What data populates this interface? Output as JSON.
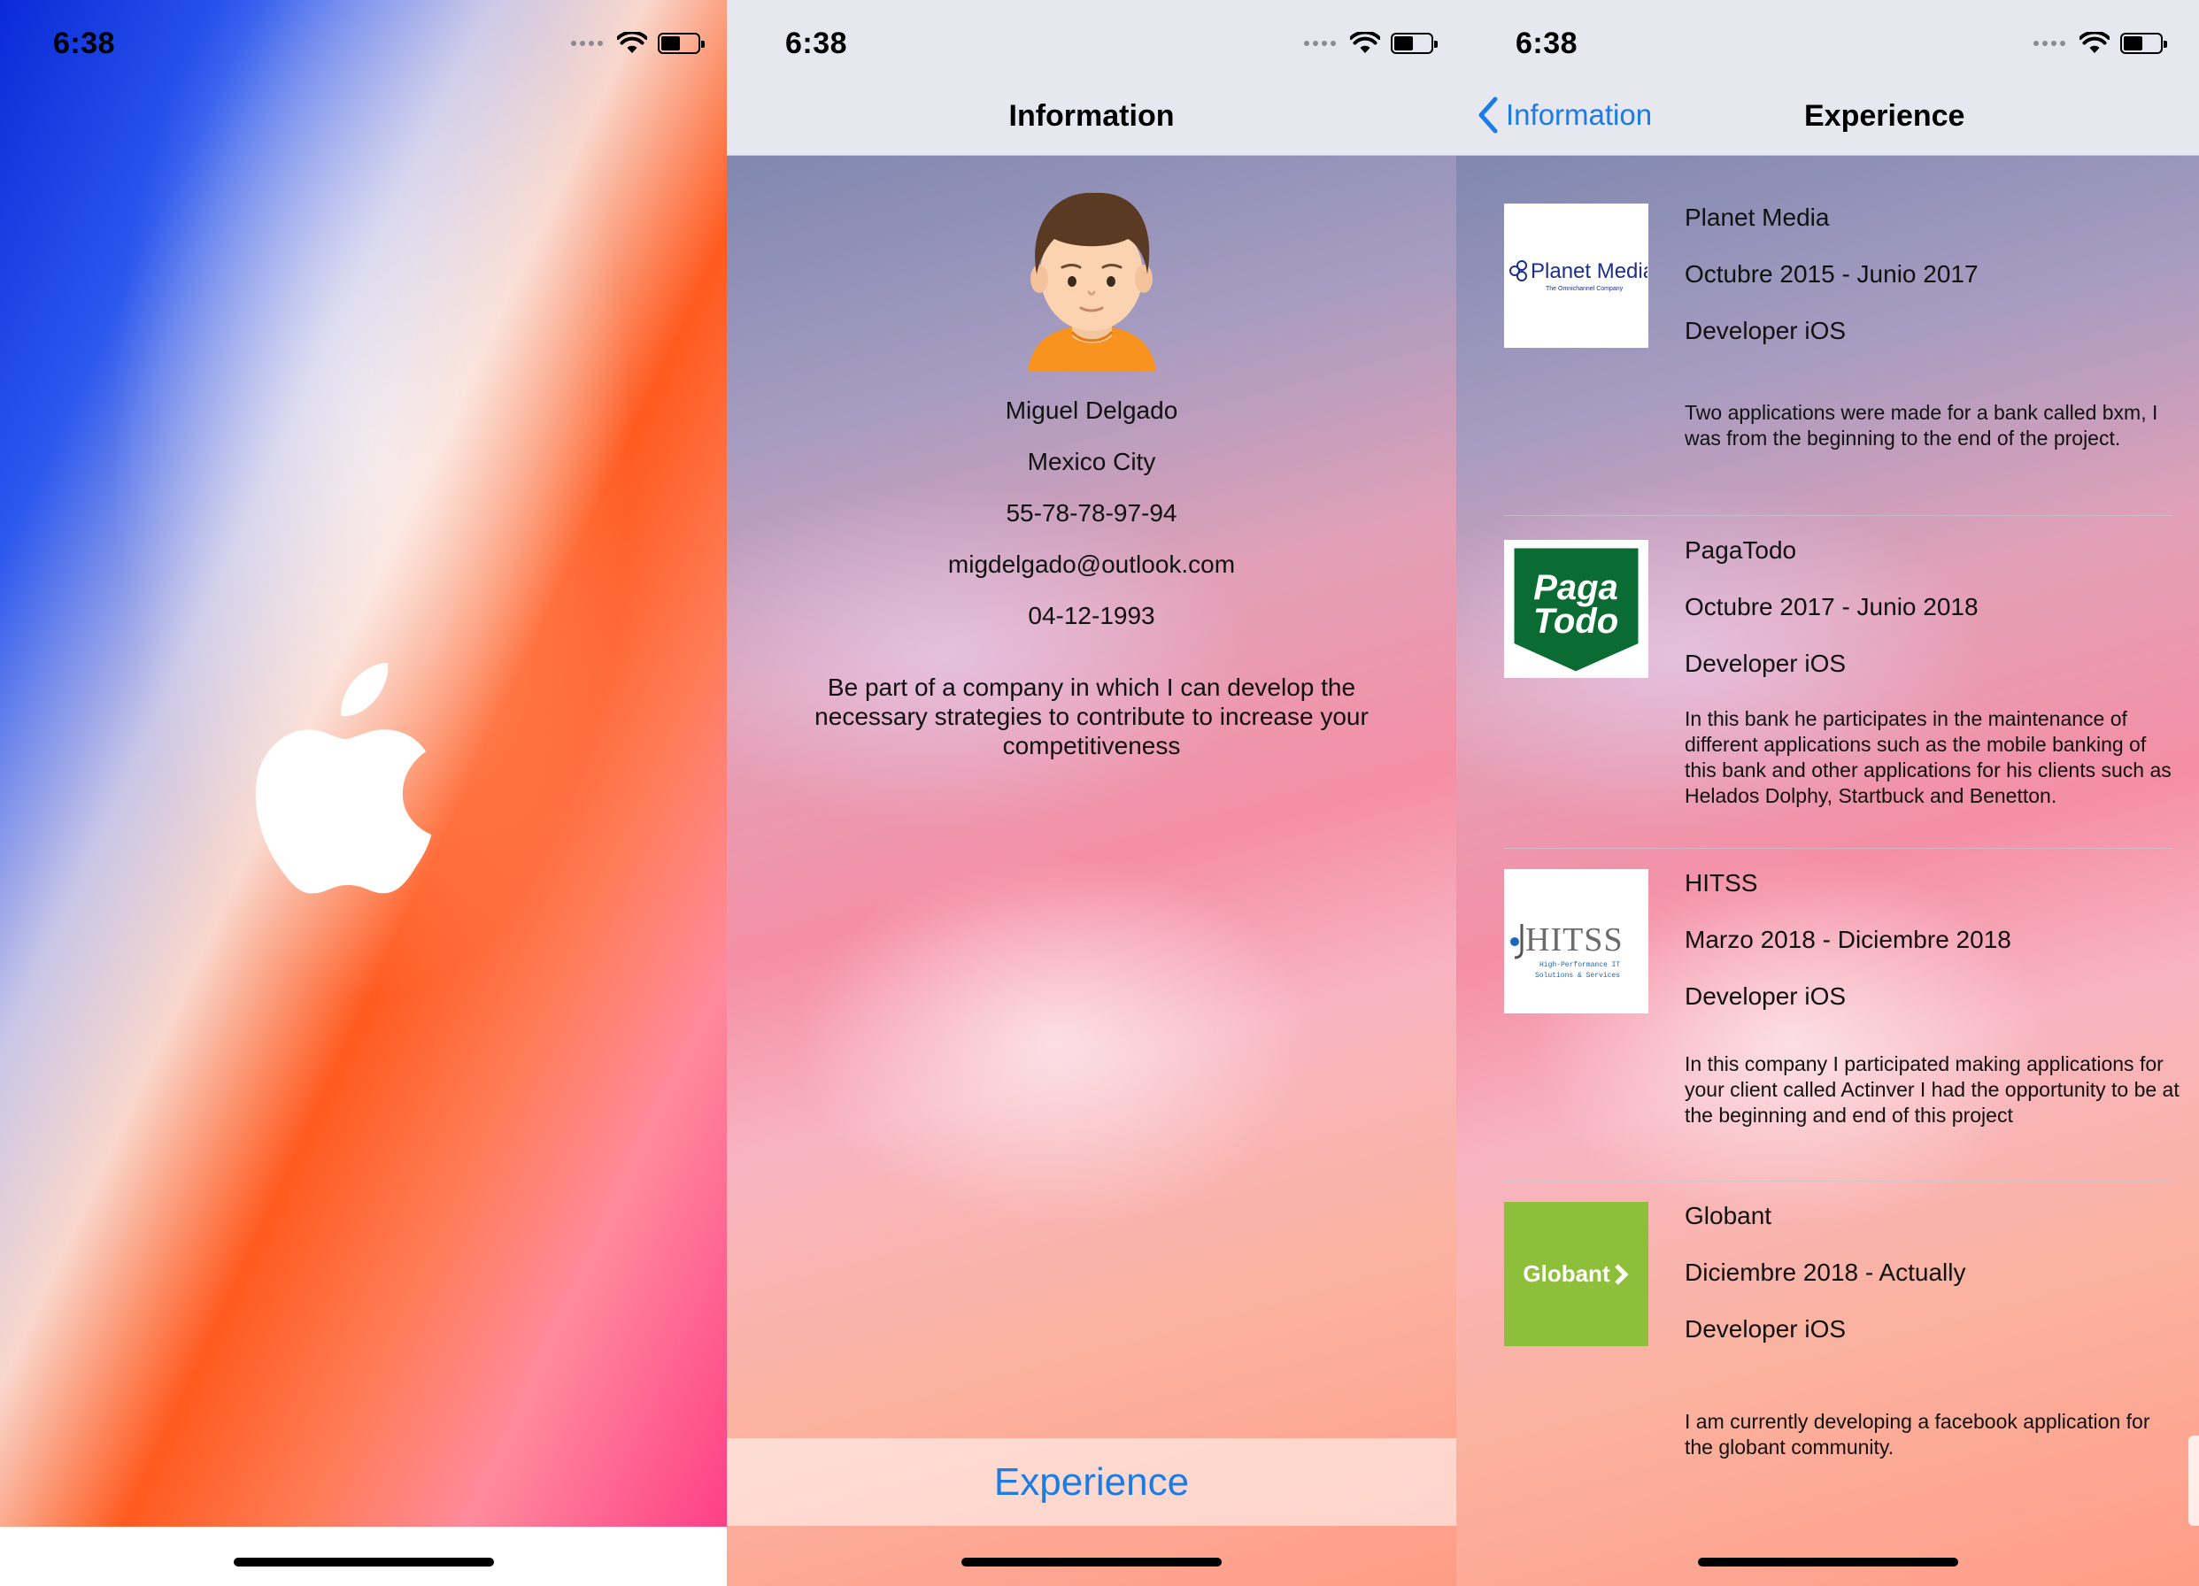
{
  "status_bar": {
    "time": "6:38"
  },
  "splash": {
    "logo_icon": "apple-logo-icon"
  },
  "information": {
    "nav_title": "Information",
    "avatar_icon": "person-avatar-icon",
    "name": "Miguel Delgado",
    "city": "Mexico City",
    "phone": "55-78-78-97-94",
    "email": "migdelgado@outlook.com",
    "birthdate": "04-12-1993",
    "objective": "Be part of a company in which I can develop the necessary strategies to contribute to increase your competitiveness",
    "experience_button": "Experience"
  },
  "experience": {
    "back_label": "Information",
    "nav_title": "Experience",
    "jobs": [
      {
        "company": "Planet Media",
        "period": "Octubre 2015 - Junio 2017",
        "role": "Developer iOS",
        "description": "Two applications were made for a bank called bxm, I was from the beginning to the end of the project.",
        "logo_text": "Planet Media",
        "logo_tagline": "The Omnichannel Company"
      },
      {
        "company": "PagaTodo",
        "period": "Octubre 2017 - Junio 2018",
        "role": "Developer iOS",
        "description": "In this bank he participates in the maintenance of different applications such as the mobile banking of this bank and other applications for his clients such as Helados Dolphy, Startbuck and Benetton.",
        "logo_text_1": "Paga",
        "logo_text_2": "Todo"
      },
      {
        "company": "HITSS",
        "period": "Marzo 2018 - Diciembre 2018",
        "role": "Developer iOS",
        "description": "In this company I participated making applications for your client called Actinver I had the opportunity to be at the beginning and end of this project",
        "logo_text": "HITSS",
        "logo_tagline_1": "High-Performance IT",
        "logo_tagline_2": "Solutions & Services"
      },
      {
        "company": "Globant",
        "period": "Diciembre 2018 - Actually",
        "role": "Developer iOS",
        "description": "I am currently developing a facebook application for the globant community.",
        "logo_text": "Globant"
      }
    ]
  },
  "colors": {
    "ios_blue": "#1a7ce4",
    "nav_bar": "#e6e7ef",
    "pagatodo_green": "#0a6b33",
    "globant_green": "#8dbf3a",
    "planet_media_blue": "#1c2f8a"
  }
}
